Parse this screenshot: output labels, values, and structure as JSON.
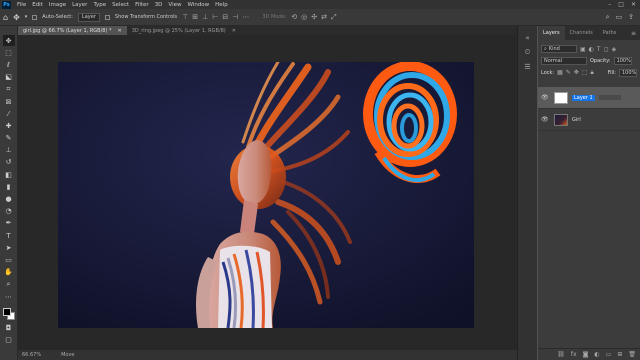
{
  "app": {
    "logo": "Ps"
  },
  "menu": [
    "File",
    "Edit",
    "Image",
    "Layer",
    "Type",
    "Select",
    "Filter",
    "3D",
    "View",
    "Window",
    "Help"
  ],
  "options": {
    "auto_select_label": "Auto-Select:",
    "auto_select_value": "Layer",
    "transform_label": "Show Transform Controls",
    "mode_3d": "3D Mode:"
  },
  "tabs": [
    {
      "label": "girl.jpg @ 66.7% (Layer 1, RGB/8) *",
      "active": true
    },
    {
      "label": "3D_ring.jpeg @ 25% (Layer 1, RGB/8)",
      "active": false
    }
  ],
  "status": {
    "zoom": "66.67%",
    "info": "Move"
  },
  "panel": {
    "tabs": [
      "Layers",
      "Channels",
      "Paths"
    ],
    "kind": "Kind",
    "blend_mode": "Normal",
    "opacity_label": "Opacity:",
    "opacity_value": "100%",
    "lock_label": "Lock:",
    "fill_label": "Fill:",
    "fill_value": "100%"
  },
  "layers": [
    {
      "name": "Layer 1",
      "selected": true,
      "editing": true
    },
    {
      "name": "Girl",
      "selected": false,
      "editing": false
    }
  ],
  "colors": {
    "accent": "#1473e6",
    "ring_orange": "#ff5a12",
    "ring_blue": "#2fa8e8",
    "backdrop": "#16183a"
  }
}
